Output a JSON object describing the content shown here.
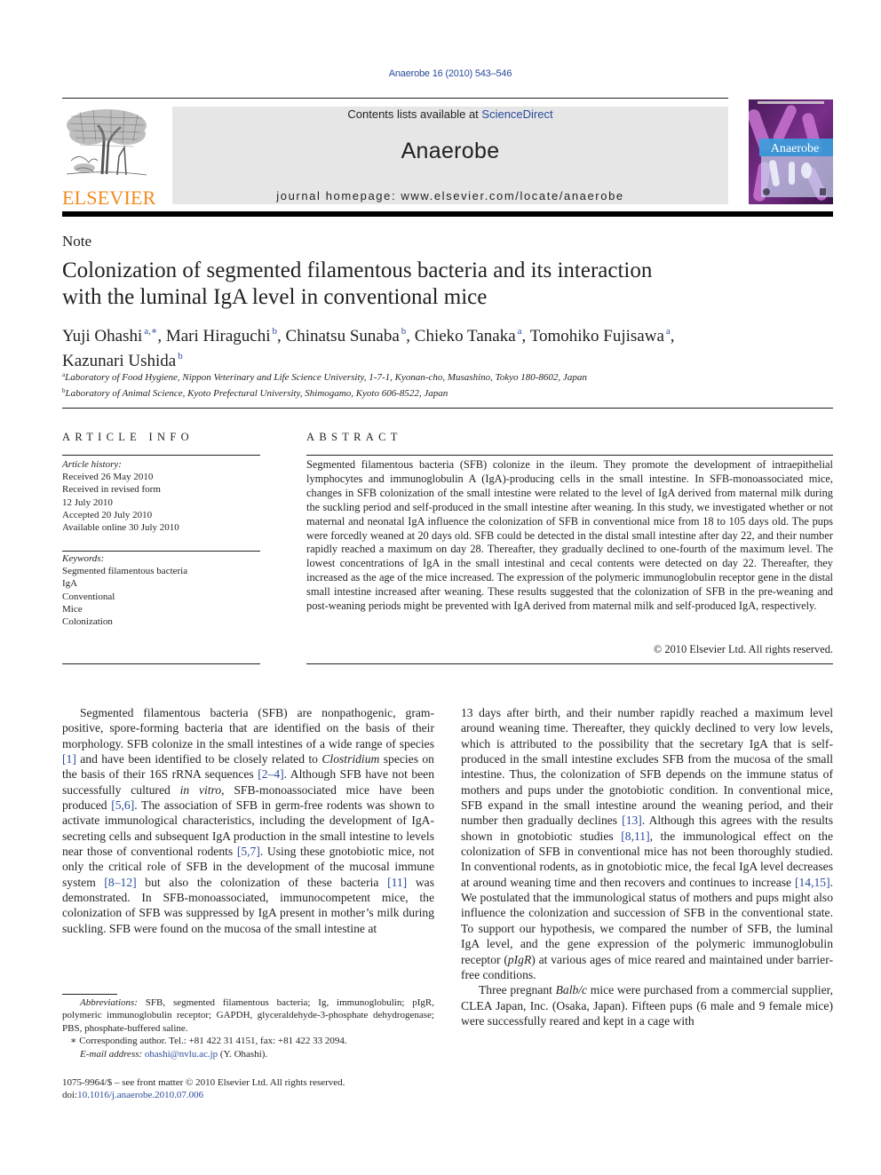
{
  "header": {
    "citation": "Anaerobe 16 (2010) 543–546",
    "contents_prefix": "Contents lists available at ",
    "contents_link": "ScienceDirect",
    "journal_name": "Anaerobe",
    "homepage": "journal homepage: www.elsevier.com/locate/anaerobe",
    "publisher_logo_text": "ELSEVIER",
    "cover_title": "Anaerobe",
    "colors": {
      "elsevier_orange": "#f28a1e",
      "link_blue": "#2a4b9b",
      "header_gray": "#e6e6e6",
      "cover_purple": "#6a2b7a",
      "cover_blue": "#3aa0de"
    }
  },
  "article": {
    "type": "Note",
    "title_line1": "Colonization of segmented filamentous bacteria and its interaction",
    "title_line2": "with the luminal IgA level in conventional mice",
    "authors": [
      {
        "name": "Yuji Ohashi",
        "aff": "a,∗",
        "sep": ", "
      },
      {
        "name": "Mari Hiraguchi",
        "aff": "b",
        "sep": ", "
      },
      {
        "name": "Chinatsu Sunaba",
        "aff": "b",
        "sep": ", "
      },
      {
        "name": "Chieko Tanaka",
        "aff": "a",
        "sep": ", "
      },
      {
        "name": "Tomohiko Fujisawa",
        "aff": "a",
        "sep": ","
      },
      {
        "name": "Kazunari Ushida",
        "aff": "b",
        "sep": ""
      }
    ],
    "affiliations": [
      {
        "mark": "a",
        "text": "Laboratory of Food Hygiene, Nippon Veterinary and Life Science University, 1-7-1, Kyonan-cho, Musashino, Tokyo 180-8602, Japan"
      },
      {
        "mark": "b",
        "text": "Laboratory of Animal Science, Kyoto Prefectural University, Shimogamo, Kyoto 606-8522, Japan"
      }
    ]
  },
  "article_info": {
    "heading": "ARTICLE INFO",
    "history_label": "Article history:",
    "history": [
      "Received 26 May 2010",
      "Received in revised form",
      "12 July 2010",
      "Accepted 20 July 2010",
      "Available online 30 July 2010"
    ],
    "keywords_label": "Keywords:",
    "keywords": [
      "Segmented filamentous bacteria",
      "IgA",
      "Conventional",
      "Mice",
      "Colonization"
    ]
  },
  "abstract": {
    "heading": "ABSTRACT",
    "text": "Segmented filamentous bacteria (SFB) colonize in the ileum. They promote the development of intraepithelial lymphocytes and immunoglobulin A (IgA)-producing cells in the small intestine. In SFB-monoassociated mice, changes in SFB colonization of the small intestine were related to the level of IgA derived from maternal milk during the suckling period and self-produced in the small intestine after weaning. In this study, we investigated whether or not maternal and neonatal IgA influence the colonization of SFB in conventional mice from 18 to 105 days old. The pups were forcedly weaned at 20 days old. SFB could be detected in the distal small intestine after day 22, and their number rapidly reached a maximum on day 28. Thereafter, they gradually declined to one-fourth of the maximum level. The lowest concentrations of IgA in the small intestinal and cecal contents were detected on day 22. Thereafter, they increased as the age of the mice increased. The expression of the polymeric immunoglobulin receptor gene in the distal small intestine increased after weaning. These results suggested that the colonization of SFB in the pre-weaning and post-weaning periods might be prevented with IgA derived from maternal milk and self-produced IgA, respectively.",
    "copyright": "© 2010 Elsevier Ltd. All rights reserved."
  },
  "body": {
    "left": {
      "p1_a": "Segmented filamentous bacteria (SFB) are nonpathogenic, gram-positive, spore-forming bacteria that are identified on the basis of their morphology. SFB colonize in the small intestines of a wide range of species ",
      "ref1": "[1]",
      "p1_b": " and have been identified to be closely related to ",
      "clostridium": "Clostridium",
      "p1_c": " species on the basis of their 16S rRNA sequences ",
      "ref2": "[2–4]",
      "p1_d": ". Although SFB have not been successfully cultured ",
      "invitro": "in vitro",
      "p1_e": ", SFB-monoassociated mice have been produced ",
      "ref3": "[5,6]",
      "p1_f": ". The association of SFB in germ-free rodents was shown to activate immunological characteristics, including the development of IgA-secreting cells and subsequent IgA production in the small intestine to levels near those of conventional rodents ",
      "ref4": "[5,7]",
      "p1_g": ". Using these gnotobiotic mice, not only the critical role of SFB in the development of the mucosal immune system ",
      "ref5": "[8–12]",
      "p1_h": " but also the colonization of these bacteria ",
      "ref6": "[11]",
      "p1_i": " was demonstrated. In SFB-monoassociated, immunocompetent mice, the colonization of SFB was suppressed by IgA present in mother’s milk during suckling. SFB were found on the mucosa of the small intestine at"
    },
    "right": {
      "p1_a": "13 days after birth, and their number rapidly reached a maximum level around weaning time. Thereafter, they quickly declined to very low levels, which is attributed to the possibility that the secretary IgA that is self-produced in the small intestine excludes SFB from the mucosa of the small intestine. Thus, the colonization of SFB depends on the immune status of mothers and pups under the gnotobiotic condition. In conventional mice, SFB expand in the small intestine around the weaning period, and their number then gradually declines ",
      "ref1": "[13]",
      "p1_b": ". Although this agrees with the results shown in gnotobiotic studies ",
      "ref2": "[8,11]",
      "p1_c": ", the immunological effect on the colonization of SFB in conventional mice has not been thoroughly studied. In conventional rodents, as in gnotobiotic mice, the fecal IgA level decreases at around weaning time and then recovers and continues to increase ",
      "ref3": "[14,15]",
      "p1_d": ". We postulated that the immunological status of mothers and pups might also influence the colonization and succession of SFB in the conventional state. To support our hypothesis, we compared the number of SFB, the luminal IgA level, and the gene expression of the polymeric immunoglobulin receptor (",
      "pigr": "pIgR",
      "p1_e": ") at various ages of mice reared and maintained under barrier-free conditions.",
      "p2_a": "Three pregnant ",
      "balbc": "Balb/c",
      "p2_b": " mice were purchased from a commercial supplier, CLEA Japan, Inc. (Osaka, Japan). Fifteen pups (6 male and 9 female mice) were successfully reared and kept in a cage with"
    }
  },
  "footnotes": {
    "abbr_label": "Abbreviations:",
    "abbr_text": " SFB, segmented filamentous bacteria; Ig, immunoglobulin; pIgR, polymeric immunoglobulin receptor; GAPDH, glyceraldehyde-3-phosphate dehydrogenase; PBS, phosphate-buffered saline.",
    "star": "∗",
    "corresponding": " Corresponding author. Tel.: +81 422 31 4151, fax: +81 422 33 2094.",
    "email_label": "E-mail address:",
    "email": "ohashi@nvlu.ac.jp",
    "email_suffix": " (Y. Ohashi).",
    "issn": "1075-9964/$ – see front matter © 2010 Elsevier Ltd. All rights reserved.",
    "doi_label": "doi:",
    "doi": "10.1016/j.anaerobe.2010.07.006"
  }
}
